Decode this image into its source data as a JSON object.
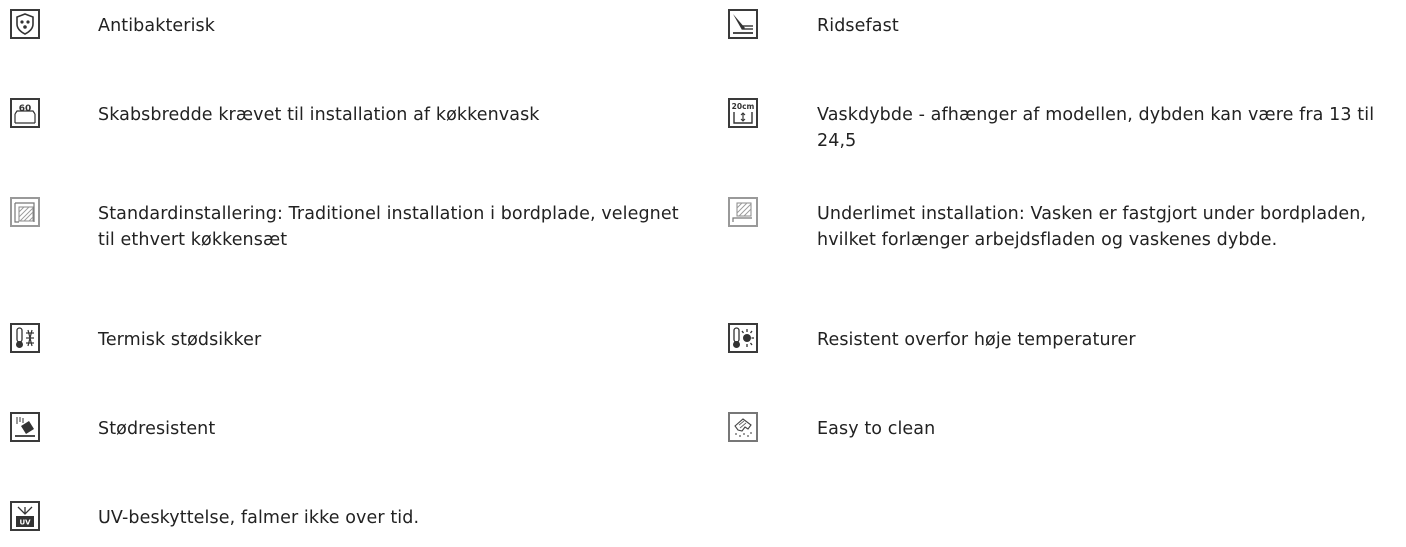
{
  "features": {
    "antibacterial": {
      "label": "Antibakterisk",
      "icon": "antibacterial-shield-icon"
    },
    "scratch": {
      "label": "Ridsefast",
      "icon": "scratch-resistant-icon"
    },
    "cabinet": {
      "label": "Skabsbredde krævet til installation af køkkenvask",
      "icon": "cabinet-width-60-icon",
      "icon_text": "60"
    },
    "depth": {
      "label": "Vaskdybde - afhænger af modellen, dybden kan være fra 13 til 24,5",
      "icon": "sink-depth-20cm-icon",
      "icon_text": "20cm"
    },
    "standard": {
      "label": "Standardinstallering: Traditionel installation i bordplade, velegnet til ethvert køkkensæt",
      "icon": "standard-installation-icon"
    },
    "undermount": {
      "label": "Underlimet installation: Vasken er fastgjort under bordpladen, hvilket forlænger arbejdsfladen og vaskenes dybde.",
      "icon": "undermount-installation-icon"
    },
    "thermal": {
      "label": "Termisk stødsikker",
      "icon": "thermal-shock-icon"
    },
    "heat": {
      "label": "Resistent overfor høje temperaturer",
      "icon": "high-temperature-icon"
    },
    "impact": {
      "label": "Stødresistent",
      "icon": "impact-resistant-icon"
    },
    "clean": {
      "label": "Easy to clean",
      "icon": "easy-to-clean-icon"
    },
    "uv": {
      "label": "UV-beskyttelse, falmer ikke over tid.",
      "icon": "uv-protection-icon",
      "icon_text": "UV"
    }
  }
}
